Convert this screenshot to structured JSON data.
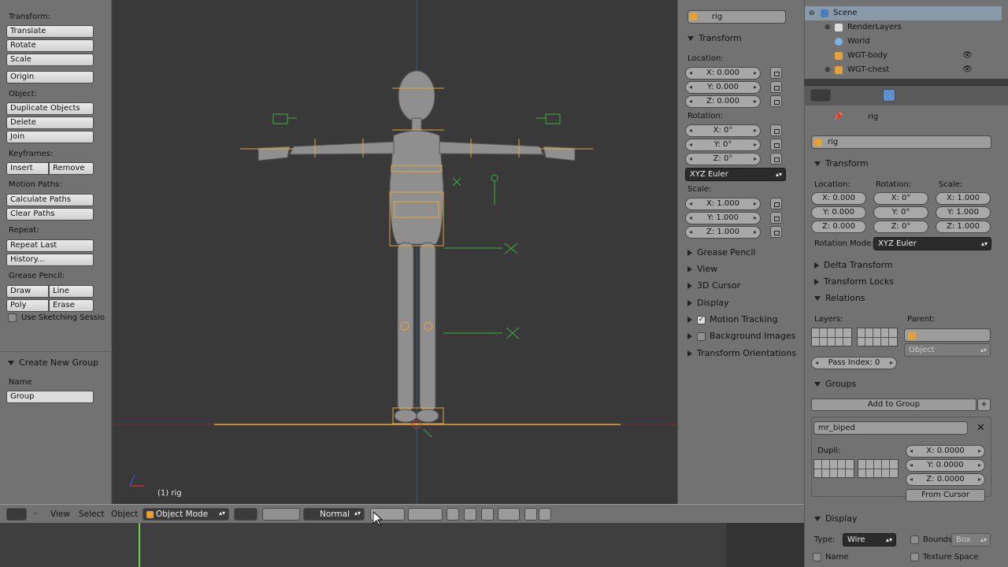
{
  "toolshelf": {
    "transform_label": "Transform:",
    "translate": "Translate",
    "rotate": "Rotate",
    "scale": "Scale",
    "origin": "Origin",
    "object_label": "Object:",
    "duplicate": "Duplicate Objects",
    "delete": "Delete",
    "join": "Join",
    "keyframes_label": "Keyframes:",
    "insert": "Insert",
    "remove": "Remove",
    "motion_paths_label": "Motion Paths:",
    "calculate_paths": "Calculate Paths",
    "clear_paths": "Clear Paths",
    "repeat_label": "Repeat:",
    "repeat_last": "Repeat Last",
    "history": "History...",
    "grease_pencil_label": "Grease Pencil:",
    "draw": "Draw",
    "line": "Line",
    "poly": "Poly",
    "erase": "Erase",
    "use_sketching": "Use Sketching Sessio",
    "create_group_header": "Create New Group",
    "name_label": "Name",
    "group_value": "Group"
  },
  "viewport": {
    "status": "(1) rig"
  },
  "n_panel": {
    "object_name": "rig",
    "transform_header": "Transform",
    "location_label": "Location:",
    "loc_x": "X: 0.000",
    "loc_y": "Y: 0.000",
    "loc_z": "Z: 0.000",
    "rotation_label": "Rotation:",
    "rot_x": "X: 0°",
    "rot_y": "Y: 0°",
    "rot_z": "Z: 0°",
    "rotation_mode": "XYZ Euler",
    "scale_label": "Scale:",
    "scale_x": "X: 1.000",
    "scale_y": "Y: 1.000",
    "scale_z": "Z: 1.000",
    "panels": [
      "Grease Pencil",
      "View",
      "3D Cursor",
      "Display",
      "Motion Tracking",
      "Background Images",
      "Transform Orientations"
    ]
  },
  "outliner": {
    "scene": "Scene",
    "render_layers": "RenderLayers",
    "world": "World",
    "wgt_body": "WGT-body",
    "wgt_chest": "WGT-chest"
  },
  "properties": {
    "breadcrumb": "rig",
    "object_name": "rig",
    "transform_header": "Transform",
    "location_label": "Location:",
    "rotation_label": "Rotation:",
    "scale_label": "Scale:",
    "loc_x": "X: 0.000",
    "loc_y": "Y: 0.000",
    "loc_z": "Z: 0.000",
    "rot_x": "X: 0°",
    "rot_y": "Y: 0°",
    "rot_z": "Z: 0°",
    "scale_x": "X: 1.000",
    "scale_y": "Y: 1.000",
    "scale_z": "Z: 1.000",
    "rotation_mode_label": "Rotation Mode:",
    "rotation_mode": "XYZ Euler",
    "delta_transform": "Delta Transform",
    "transform_locks": "Transform Locks",
    "relations": "Relations",
    "layers_label": "Layers:",
    "parent_label": "Parent:",
    "parent_type": "Object",
    "pass_index": "Pass Index: 0",
    "groups": "Groups",
    "add_to_group": "Add to Group",
    "group_name": "mr_biped",
    "dupli_label": "Dupli:",
    "dupli_x": "X: 0.0000",
    "dupli_y": "Y: 0.0000",
    "dupli_z": "Z: 0.0000",
    "from_cursor": "From Cursor",
    "display": "Display",
    "type_label": "Type:",
    "type_value": "Wire",
    "bounds": "Bounds",
    "bounds_type": "Box",
    "name": "Name",
    "texture_space": "Texture Space"
  },
  "header": {
    "view": "View",
    "select": "Select",
    "object": "Object",
    "mode": "Object Mode",
    "pivot": "Normal"
  },
  "colors": {
    "panel_bg": "#727272",
    "viewport_bg": "#393939",
    "bone_selected": "#e8a43a",
    "bone_widget": "#3fae3f",
    "x_axis": "#c03030"
  }
}
